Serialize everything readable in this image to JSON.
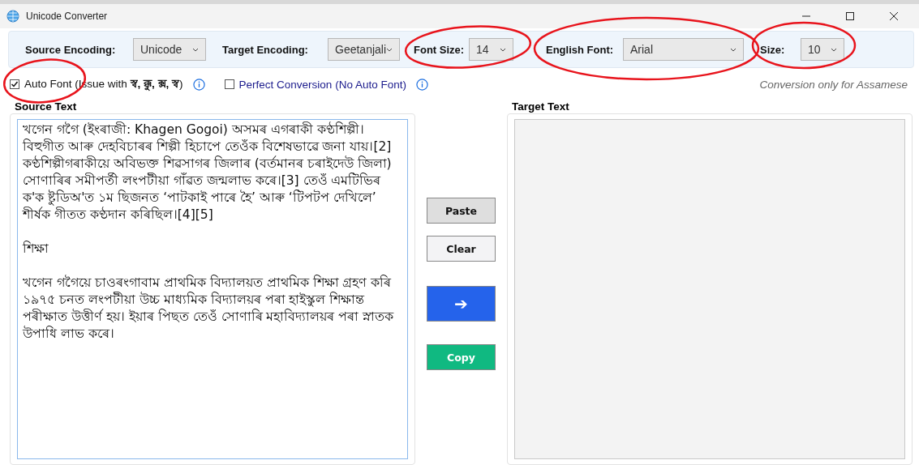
{
  "window": {
    "title": "Unicode Converter"
  },
  "toolbar": [
    {
      "label": "Source Encoding:",
      "value": "Unicode"
    },
    {
      "label": "Target Encoding:",
      "value": "Geetanjali"
    },
    {
      "label": "Font Size:",
      "value": "14"
    },
    {
      "label": "English Font:",
      "value": "Arial"
    },
    {
      "label": "Size:",
      "value": "10"
    }
  ],
  "options": [
    {
      "kind": "plain",
      "label": "Auto Font (Issue with **স্ব, ক্কু, ক্স, স্ব**)",
      "checked": true
    },
    {
      "kind": "link",
      "label": "Perfect Conversion (No Auto Font)",
      "checked": false
    }
  ],
  "note": "Conversion only for Assamese",
  "source": {
    "title": "Source Text",
    "value": "খগেন গগৈ (ইংৰাজী: Khagen Gogoi) অসমৰ এগৰাকী কণ্ঠশিল্পী। বিহুগীত আৰু দেহবিচাৰৰ শিল্পী হিচাপে তেওঁক বিশেষভাৱে জনা যায়।[2] কণ্ঠশিল্পীগৰাকীয়ে অবিভক্ত শিৱসাগৰ জিলাৰ (বৰ্তমানৰ চৰাইদেউ জিলা) সোণাৰিৰ সমীপৰ্তী লংপটীয়া গাঁৱত জন্মলাভ কৰে।[3] তেওঁ এমটিভিৰ ক'ক ষ্টুডিঅ'ত ১ম ছিজনত ‘পাটকাই পাৰে হৈ’ আৰু ‘টিপটপ দেখিলে’ শীৰ্ষক গীতত কণ্ঠদান কৰিছিল।[4][5]\n\nশিক্ষা\n\nখগেন গগৈয়ে চাওৰংগাবাম প্ৰাথমিক বিদ্যালয়ত প্ৰাথমিক শিক্ষা গ্ৰহণ কৰি ১৯৭৫ চনত লংপটীয়া উচ্চ মাধ্যমিক বিদ্যালয়ৰ পৰা হাইস্কুল শিক্ষান্ত পৰীক্ষাত উত্তীৰ্ণ হয়। ইয়াৰ পিছত তেওঁ সোণাৰি মহাবিদ্যালয়ৰ পৰা স্নাতক উপাধি লাভ কৰে।"
  },
  "actions": [
    {
      "kind": "paste",
      "label": "Paste"
    },
    {
      "kind": "clear",
      "label": "Clear"
    },
    {
      "kind": "convert",
      "label": "➔"
    },
    {
      "kind": "copy",
      "label": "Copy"
    }
  ],
  "target": {
    "title": "Target Text"
  }
}
